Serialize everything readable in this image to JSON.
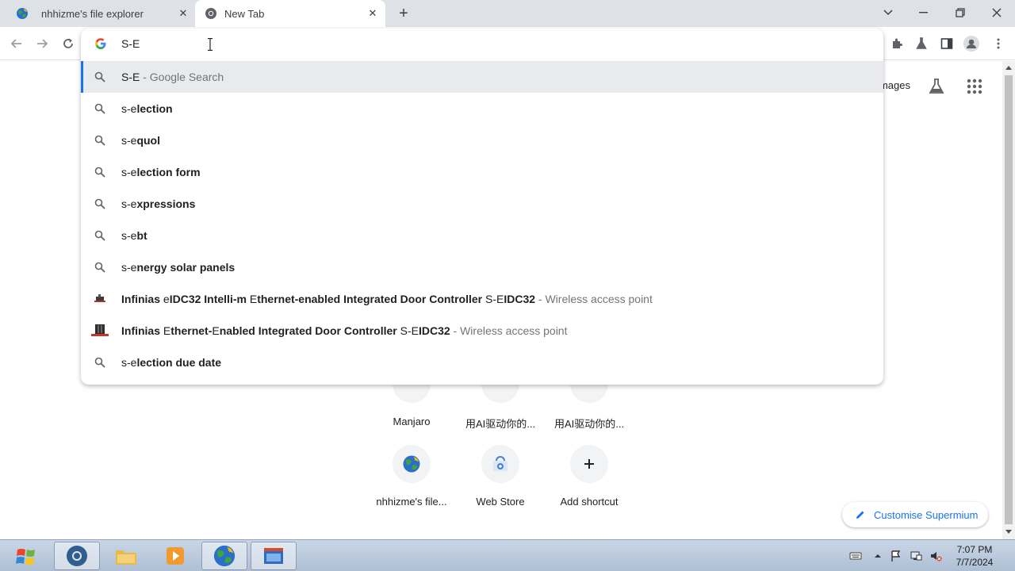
{
  "tabs": [
    {
      "title": "nhhizme's file explorer",
      "favicon": "globe-icon"
    },
    {
      "title": "New Tab",
      "favicon": "chromium-icon"
    }
  ],
  "omnibox": {
    "value": "S-E",
    "suggestions": [
      {
        "prefix": "S-E",
        "bold": "",
        "suffix": " - Google Search",
        "icon": "search-icon"
      },
      {
        "prefix": "s-e",
        "bold": "lection",
        "suffix": "",
        "icon": "search-icon"
      },
      {
        "prefix": "s-e",
        "bold": "quol",
        "suffix": "",
        "icon": "search-icon"
      },
      {
        "prefix": "s-e",
        "bold": "lection form",
        "suffix": "",
        "icon": "search-icon"
      },
      {
        "prefix": "s-e",
        "bold": "xpressions",
        "suffix": "",
        "icon": "search-icon"
      },
      {
        "prefix": "s-e",
        "bold": "bt",
        "suffix": "",
        "icon": "search-icon"
      },
      {
        "prefix": "s-e",
        "bold": "nergy solar panels",
        "suffix": "",
        "icon": "search-icon"
      },
      {
        "bold_a": "Infinias ",
        "plain_a": "e",
        "bold_b": "IDC32 Intelli-m ",
        "plain_b": "E",
        "bold_c": "thernet-enabled Integrated Door Controller ",
        "plain_c": "S-E",
        "bold_d": "IDC32",
        "sub": " - Wireless access point",
        "icon": "product-thumbnail"
      },
      {
        "bold_a": "Infinias ",
        "plain_a": "E",
        "bold_b": "thernet-",
        "plain_b": "E",
        "bold_c": "nabled Integrated Door Controller ",
        "plain_c": "S-E",
        "bold_d": "IDC32",
        "sub": " - Wireless access point",
        "icon": "product-thumbnail"
      },
      {
        "prefix": "s-e",
        "bold": "lection due date",
        "suffix": "",
        "icon": "search-icon"
      }
    ]
  },
  "page": {
    "images_link": "Images",
    "shortcuts_row1": [
      "Manjaro",
      "用AI驱动你的...",
      "用AI驱动你的..."
    ],
    "shortcuts_row2": [
      "nhhizme's file...",
      "Web Store",
      "Add shortcut"
    ],
    "customise_label": "Customise Supermium"
  },
  "taskbar": {
    "time": "7:07 PM",
    "date": "7/7/2024"
  },
  "colors": {
    "accent": "#1a73e8",
    "tabstrip": "#dee1e6",
    "selected_row": "#e8eaed"
  }
}
